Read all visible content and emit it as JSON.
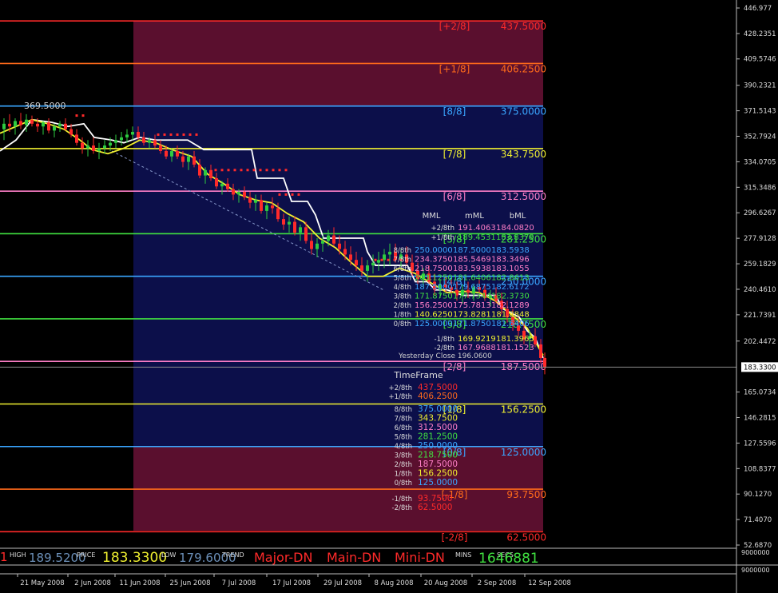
{
  "chart_data": {
    "type": "candlestick",
    "title": "",
    "xlabel": "",
    "ylabel": "",
    "ylim": [
      52.687,
      446.977
    ],
    "y_ticks": [
      "446.977",
      "428.2351",
      "409.5746",
      "390.2321",
      "371.5143",
      "352.7924",
      "334.0705",
      "315.3486",
      "296.6267",
      "277.9128",
      "259.1829",
      "240.4610",
      "221.7391",
      "202.4472",
      "183.3300",
      "165.0734",
      "146.2815",
      "127.5596",
      "108.8377",
      "90.1270",
      "71.4070",
      "52.6870"
    ],
    "x_ticks": [
      "21 May 2008",
      "2 Jun 2008",
      "11 Jun 2008",
      "25 Jun 2008",
      "7 Jul 2008",
      "17 Jul 2008",
      "29 Jul 2008",
      "8 Aug 2008",
      "20 Aug 2008",
      "2 Sep 2008",
      "12 Sep 2008"
    ],
    "current_price_label": "183.3300",
    "peak_annotation": "369.5000",
    "yesterday_close": "Yesterday Close 196.0600",
    "levels": [
      {
        "tag": "[+2/8]",
        "value": 437.5,
        "label": "437.5000",
        "color": "#ff2a2a"
      },
      {
        "tag": "[+1/8]",
        "value": 406.25,
        "label": "406.2500",
        "color": "#ff6a1a"
      },
      {
        "tag": "[8/8]",
        "value": 375.0,
        "label": "375.0000",
        "color": "#3aa6ff"
      },
      {
        "tag": "[7/8]",
        "value": 343.75,
        "label": "343.7500",
        "color": "#f0f030"
      },
      {
        "tag": "[6/8]",
        "value": 312.5,
        "label": "312.5000",
        "color": "#ff7fc8"
      },
      {
        "tag": "[5/8]",
        "value": 281.25,
        "label": "281.2500",
        "color": "#40e040"
      },
      {
        "tag": "[4/8]",
        "value": 250.0,
        "label": "250.0000",
        "color": "#3aa6ff"
      },
      {
        "tag": "[3/8]",
        "value": 218.75,
        "label": "218.7500",
        "color": "#40e040"
      },
      {
        "tag": "[2/8]",
        "value": 187.5,
        "label": "187.5000",
        "color": "#ff7fc8"
      },
      {
        "tag": "[1/8]",
        "value": 156.25,
        "label": "156.2500",
        "color": "#f0f030"
      },
      {
        "tag": "[0/8]",
        "value": 125.0,
        "label": "125.0000",
        "color": "#3aa6ff"
      },
      {
        "tag": "[-1/8]",
        "value": 93.75,
        "label": "93.7500",
        "color": "#ff6a1a"
      },
      {
        "tag": "[-2/8]",
        "value": 62.5,
        "label": "62.5000",
        "color": "#ff2a2a"
      }
    ],
    "white_line": [
      [
        0,
        342
      ],
      [
        20,
        350
      ],
      [
        40,
        365
      ],
      [
        65,
        363
      ],
      [
        85,
        360
      ],
      [
        105,
        362
      ],
      [
        118,
        352
      ],
      [
        140,
        350
      ],
      [
        155,
        348
      ],
      [
        175,
        352
      ],
      [
        195,
        350
      ],
      [
        235,
        350
      ],
      [
        255,
        343
      ],
      [
        315,
        343
      ],
      [
        322,
        322
      ],
      [
        355,
        322
      ],
      [
        365,
        305
      ],
      [
        385,
        305
      ],
      [
        395,
        295
      ],
      [
        405,
        278
      ],
      [
        455,
        278
      ],
      [
        460,
        268
      ],
      [
        470,
        258
      ],
      [
        510,
        258
      ],
      [
        520,
        246
      ],
      [
        535,
        246
      ],
      [
        545,
        240
      ],
      [
        560,
        240
      ],
      [
        580,
        236
      ],
      [
        620,
        236
      ],
      [
        630,
        226
      ],
      [
        650,
        220
      ],
      [
        660,
        210
      ],
      [
        670,
        205
      ],
      [
        680,
        190
      ]
    ],
    "yellow_line": [
      [
        0,
        355
      ],
      [
        20,
        360
      ],
      [
        40,
        365
      ],
      [
        60,
        362
      ],
      [
        80,
        358
      ],
      [
        100,
        350
      ],
      [
        115,
        343
      ],
      [
        135,
        340
      ],
      [
        155,
        344
      ],
      [
        175,
        350
      ],
      [
        195,
        348
      ],
      [
        215,
        343
      ],
      [
        240,
        338
      ],
      [
        260,
        325
      ],
      [
        280,
        318
      ],
      [
        300,
        310
      ],
      [
        320,
        306
      ],
      [
        340,
        304
      ],
      [
        360,
        296
      ],
      [
        380,
        290
      ],
      [
        400,
        278
      ],
      [
        420,
        271
      ],
      [
        440,
        260
      ],
      [
        460,
        250
      ],
      [
        480,
        250
      ],
      [
        500,
        256
      ],
      [
        520,
        252
      ],
      [
        540,
        245
      ],
      [
        560,
        238
      ],
      [
        580,
        239
      ],
      [
        600,
        238
      ],
      [
        620,
        232
      ],
      [
        640,
        222
      ],
      [
        660,
        212
      ],
      [
        680,
        192
      ]
    ],
    "dashed_trend": [
      [
        140,
        342
      ],
      [
        480,
        240
      ]
    ],
    "candles": [
      [
        5,
        358,
        366,
        350,
        362
      ],
      [
        12,
        362,
        369,
        356,
        360
      ],
      [
        19,
        360,
        366,
        354,
        364
      ],
      [
        26,
        364,
        370,
        358,
        361
      ],
      [
        33,
        361,
        369,
        356,
        365
      ],
      [
        40,
        365,
        368,
        360,
        362
      ],
      [
        47,
        362,
        366,
        356,
        360
      ],
      [
        54,
        360,
        364,
        354,
        363
      ],
      [
        61,
        363,
        366,
        355,
        357
      ],
      [
        68,
        357,
        362,
        352,
        360
      ],
      [
        75,
        360,
        364,
        356,
        362
      ],
      [
        82,
        362,
        366,
        357,
        358
      ],
      [
        89,
        358,
        362,
        352,
        354
      ],
      [
        96,
        354,
        358,
        346,
        348
      ],
      [
        103,
        348,
        352,
        340,
        344
      ],
      [
        110,
        344,
        350,
        338,
        346
      ],
      [
        117,
        346,
        352,
        340,
        342
      ],
      [
        124,
        342,
        348,
        336,
        344
      ],
      [
        131,
        344,
        350,
        340,
        346
      ],
      [
        138,
        346,
        352,
        342,
        348
      ],
      [
        145,
        348,
        354,
        344,
        350
      ],
      [
        152,
        350,
        356,
        346,
        352
      ],
      [
        159,
        352,
        358,
        348,
        354
      ],
      [
        166,
        354,
        360,
        350,
        356
      ],
      [
        173,
        356,
        360,
        350,
        352
      ],
      [
        180,
        352,
        356,
        346,
        348
      ],
      [
        187,
        348,
        352,
        344,
        350
      ],
      [
        194,
        350,
        354,
        344,
        346
      ],
      [
        201,
        346,
        350,
        340,
        342
      ],
      [
        208,
        342,
        346,
        336,
        338
      ],
      [
        215,
        338,
        344,
        334,
        342
      ],
      [
        222,
        342,
        346,
        336,
        338
      ],
      [
        229,
        338,
        342,
        330,
        334
      ],
      [
        236,
        334,
        340,
        328,
        338
      ],
      [
        243,
        338,
        342,
        330,
        332
      ],
      [
        250,
        332,
        336,
        322,
        324
      ],
      [
        257,
        324,
        330,
        318,
        328
      ],
      [
        264,
        328,
        332,
        320,
        322
      ],
      [
        271,
        322,
        326,
        314,
        316
      ],
      [
        278,
        316,
        320,
        310,
        318
      ],
      [
        285,
        318,
        322,
        312,
        314
      ],
      [
        292,
        314,
        318,
        306,
        310
      ],
      [
        299,
        310,
        314,
        304,
        312
      ],
      [
        306,
        312,
        316,
        306,
        308
      ],
      [
        313,
        308,
        312,
        300,
        304
      ],
      [
        320,
        304,
        310,
        298,
        306
      ],
      [
        327,
        306,
        310,
        296,
        298
      ],
      [
        334,
        298,
        304,
        292,
        302
      ],
      [
        341,
        302,
        308,
        296,
        300
      ],
      [
        348,
        300,
        304,
        290,
        292
      ],
      [
        355,
        292,
        296,
        284,
        288
      ],
      [
        362,
        288,
        294,
        282,
        290
      ],
      [
        369,
        290,
        294,
        280,
        282
      ],
      [
        376,
        282,
        288,
        276,
        286
      ],
      [
        383,
        286,
        290,
        274,
        276
      ],
      [
        390,
        276,
        282,
        266,
        270
      ],
      [
        397,
        270,
        278,
        264,
        274
      ],
      [
        404,
        274,
        280,
        268,
        276
      ],
      [
        411,
        276,
        284,
        272,
        280
      ],
      [
        418,
        280,
        286,
        272,
        274
      ],
      [
        425,
        274,
        280,
        266,
        270
      ],
      [
        432,
        270,
        276,
        262,
        266
      ],
      [
        439,
        266,
        272,
        258,
        262
      ],
      [
        446,
        262,
        268,
        254,
        258
      ],
      [
        453,
        258,
        264,
        250,
        254
      ],
      [
        460,
        254,
        262,
        246,
        258
      ],
      [
        467,
        258,
        266,
        252,
        260
      ],
      [
        474,
        260,
        268,
        254,
        262
      ],
      [
        481,
        262,
        270,
        256,
        266
      ],
      [
        488,
        266,
        274,
        258,
        268
      ],
      [
        495,
        268,
        274,
        260,
        262
      ],
      [
        502,
        262,
        270,
        256,
        266
      ],
      [
        509,
        266,
        272,
        258,
        260
      ],
      [
        516,
        260,
        266,
        250,
        254
      ],
      [
        523,
        254,
        260,
        244,
        248
      ],
      [
        530,
        248,
        256,
        242,
        252
      ],
      [
        537,
        252,
        258,
        244,
        246
      ],
      [
        544,
        246,
        252,
        236,
        240
      ],
      [
        551,
        240,
        248,
        234,
        244
      ],
      [
        558,
        244,
        250,
        238,
        242
      ],
      [
        565,
        242,
        248,
        236,
        240
      ],
      [
        572,
        240,
        246,
        232,
        236
      ],
      [
        579,
        236,
        244,
        230,
        240
      ],
      [
        586,
        240,
        246,
        234,
        238
      ],
      [
        593,
        238,
        244,
        232,
        242
      ],
      [
        600,
        242,
        248,
        236,
        240
      ],
      [
        607,
        240,
        244,
        232,
        234
      ],
      [
        614,
        234,
        240,
        228,
        236
      ],
      [
        621,
        236,
        242,
        230,
        232
      ],
      [
        628,
        232,
        238,
        222,
        226
      ],
      [
        635,
        226,
        232,
        216,
        220
      ],
      [
        642,
        220,
        226,
        210,
        214
      ],
      [
        649,
        214,
        220,
        206,
        210
      ],
      [
        656,
        210,
        216,
        200,
        204
      ],
      [
        663,
        204,
        210,
        196,
        206
      ],
      [
        670,
        206,
        212,
        198,
        200
      ],
      [
        677,
        200,
        204,
        186,
        190
      ],
      [
        682,
        190,
        194,
        178,
        183
      ]
    ],
    "stop_dots": [
      [
        96,
        368
      ],
      [
        104,
        368
      ],
      [
        198,
        354
      ],
      [
        206,
        354
      ],
      [
        214,
        354
      ],
      [
        222,
        354
      ],
      [
        230,
        354
      ],
      [
        238,
        354
      ],
      [
        246,
        354
      ],
      [
        270,
        328
      ],
      [
        278,
        328
      ],
      [
        286,
        328
      ],
      [
        294,
        328
      ],
      [
        302,
        328
      ],
      [
        310,
        328
      ],
      [
        318,
        328
      ],
      [
        326,
        328
      ],
      [
        334,
        328
      ],
      [
        342,
        328
      ],
      [
        350,
        328
      ],
      [
        358,
        328
      ],
      [
        350,
        310
      ],
      [
        358,
        310
      ],
      [
        366,
        310
      ],
      [
        374,
        310
      ],
      [
        470,
        262
      ],
      [
        478,
        262
      ],
      [
        486,
        262
      ],
      [
        494,
        262
      ],
      [
        502,
        262
      ],
      [
        510,
        262
      ]
    ],
    "mml_table": {
      "headers": [
        "MML",
        "mML",
        "bML"
      ],
      "rows": [
        {
          "label": "+2/8th",
          "mml": "191.4063",
          "mml2": "184.0820",
          "bml": ""
        },
        {
          "label": "+1/8th",
          "mml": "189.4531",
          "mml2": "183.8379",
          "bml": ""
        },
        {
          "label": "8/8th",
          "mml": "250.0000",
          "mml2": "187.5000",
          "bml": "183.5938"
        },
        {
          "label": "7/8th",
          "mml": "234.3750",
          "mml2": "185.5469",
          "bml": "183.3496"
        },
        {
          "label": "6/8th",
          "mml": "218.7500",
          "mml2": "183.5938",
          "bml": "183.1055"
        },
        {
          "label": "5/8th",
          "mml": "203.1250",
          "mml2": "181.6406",
          "bml": "182.8613"
        },
        {
          "label": "4/8th",
          "mml": "187.5000",
          "mml2": "179.6875",
          "bml": "182.6172"
        },
        {
          "label": "3/8th",
          "mml": "171.8750",
          "mml2": "177.7344",
          "bml": "182.3730"
        },
        {
          "label": "2/8th",
          "mml": "156.2500",
          "mml2": "175.7813",
          "bml": "182.1289"
        },
        {
          "label": "1/8th",
          "mml": "140.6250",
          "mml2": "173.8281",
          "bml": "181.8848"
        },
        {
          "label": "0/8th",
          "mml": "125.0000",
          "mml2": "171.8750",
          "bml": "181.6406"
        },
        {
          "label": "-1/8th",
          "mml": "169.9219",
          "mml2": "181.3965",
          "bml": ""
        },
        {
          "label": "-2/8th",
          "mml": "167.9688",
          "mml2": "181.1523",
          "bml": ""
        }
      ]
    },
    "timeframe_table": {
      "title": "TimeFrame",
      "rows": [
        {
          "label": "+2/8th",
          "value": "437.5000",
          "color": "#ff2a2a"
        },
        {
          "label": "+1/8th",
          "value": "406.2500",
          "color": "#ff6a1a"
        },
        {
          "label": "8/8th",
          "value": "375.0000",
          "color": "#3aa6ff"
        },
        {
          "label": "7/8th",
          "value": "343.7500",
          "color": "#f0f030"
        },
        {
          "label": "6/8th",
          "value": "312.5000",
          "color": "#ff7fc8"
        },
        {
          "label": "5/8th",
          "value": "281.2500",
          "color": "#40e040"
        },
        {
          "label": "4/8th",
          "value": "250.0000",
          "color": "#3aa6ff"
        },
        {
          "label": "3/8th",
          "value": "218.7500",
          "color": "#40e040"
        },
        {
          "label": "2/8th",
          "value": "187.5000",
          "color": "#ff7fc8"
        },
        {
          "label": "1/8th",
          "value": "156.2500",
          "color": "#f0f030"
        },
        {
          "label": "0/8th",
          "value": "125.0000",
          "color": "#3aa6ff"
        },
        {
          "label": "-1/8th",
          "value": "93.7500",
          "color": "#ff2a2a"
        },
        {
          "label": "-2/8th",
          "value": "62.5000",
          "color": "#ff2a2a"
        }
      ]
    }
  },
  "status_bar": {
    "lead": "1",
    "high_label": "HIGH",
    "high_value": "189.5200",
    "price_label": "PRICE",
    "price_value": "183.3300",
    "low_label": "LOW",
    "low_value": "179.6000",
    "trend_label": "TREND",
    "trend_major": "Major-DN",
    "trend_main": "Main-DN",
    "trend_mini": "Mini-DN",
    "mins_label": "MINS",
    "secs_label": "SECS",
    "timer_value": "1646881"
  },
  "sub_axis": {
    "top": "9000000",
    "bottom": "9000000"
  },
  "colors": {
    "background": "#000000",
    "zone_maroon": "#5a0f2e",
    "zone_navy": "#0c0f4a",
    "white_line": "#ffffff",
    "yellow_line": "#f0f030",
    "bull": "#2ecc40",
    "bear": "#ff2a2a",
    "current_price_line": "#8a8a8a"
  }
}
